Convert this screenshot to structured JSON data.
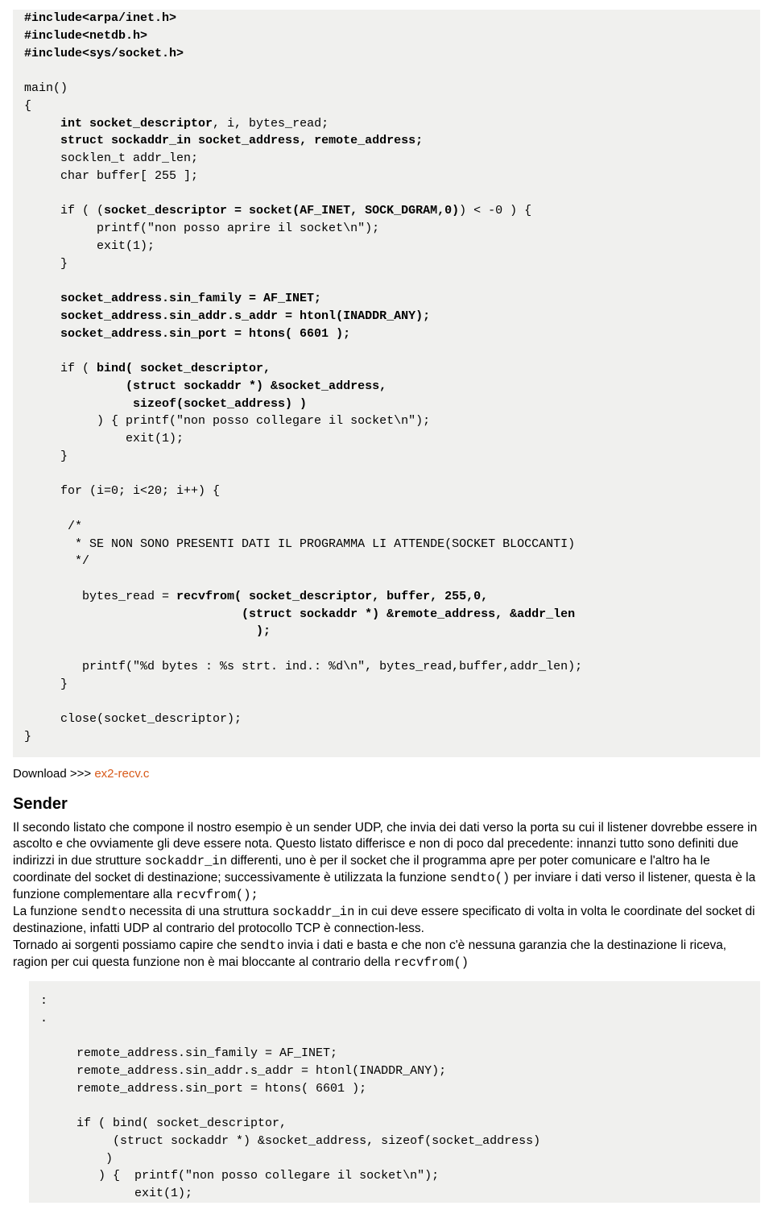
{
  "code1": {
    "l01": "#include<arpa/inet.h>",
    "l02": "#include<netdb.h>",
    "l03": "#include<sys/socket.h>",
    "l04": "",
    "l05": "main()",
    "l06": "{",
    "l07a": "     ",
    "l07b": "int socket_descriptor",
    "l07c": ", i, bytes_read;",
    "l08a": "     ",
    "l08b": "struct sockaddr_in socket_address, remote_address;",
    "l09": "     socklen_t addr_len;",
    "l10": "     char buffer[ 255 ];",
    "l11": "",
    "l12a": "     if ( (",
    "l12b": "socket_descriptor = socket(AF_INET, SOCK_DGRAM,0)",
    "l12c": ") < -0 ) {",
    "l13": "          printf(\"non posso aprire il socket\\n\");",
    "l14": "          exit(1);",
    "l15": "     }",
    "l16": "",
    "l17": "     socket_address.sin_family = AF_INET;",
    "l18": "     socket_address.sin_addr.s_addr = htonl(INADDR_ANY);",
    "l19": "     socket_address.sin_port = htons( 6601 );",
    "l20": "",
    "l21a": "     if ( ",
    "l21b": "bind( socket_descriptor,",
    "l22": "              (struct sockaddr *) &socket_address,",
    "l23": "               sizeof(socket_address) )",
    "l24": "          ) { printf(\"non posso collegare il socket\\n\");",
    "l25": "              exit(1);",
    "l26": "     }",
    "l27": "",
    "l28": "     for (i=0; i<20; i++) {",
    "l29": "",
    "l30": "      /*",
    "l31": "       * SE NON SONO PRESENTI DATI IL PROGRAMMA LI ATTENDE(SOCKET BLOCCANTI)",
    "l32": "       */",
    "l33": "",
    "l34a": "        bytes_read = ",
    "l34b": "recvfrom( socket_descriptor, buffer, 255,0,",
    "l35": "                              (struct sockaddr *) &remote_address, &addr_len",
    "l36": "                                );",
    "l37": "",
    "l38": "        printf(\"%d bytes : %s strt. ind.: %d\\n\", bytes_read,buffer,addr_len);",
    "l39": "     }",
    "l40": "",
    "l41": "     close(socket_descriptor);",
    "l42": "}"
  },
  "download": {
    "label": "Download >>> ",
    "link": "ex2-recv.c"
  },
  "heading": "Sender",
  "prose": {
    "p1a": "Il secondo listato che compone il nostro esempio è un sender UDP, che invia dei dati verso la porta su cui il listener dovrebbe essere in ascolto e che ovviamente gli deve essere nota. Questo listato differisce e non di poco dal precedente: innanzi tutto sono definiti due indirizzi in due strutture ",
    "p1b": "sockaddr_in",
    "p1c": "  differenti, uno è per il socket che il programma apre per poter comunicare e l'altro ha le coordinate del socket di destinazione; successivamente è utilizzata la funzione ",
    "p1d": "sendto()",
    "p1e": " per inviare i dati verso il listener, questa è la funzione complementare alla ",
    "p1f": "recvfrom();",
    "p2a": "La funzione ",
    "p2b": "sendto",
    "p2c": " necessita di una struttura ",
    "p2d": "sockaddr_in",
    "p2e": " in cui deve essere specificato di volta in volta le coordinate del socket di destinazione, infatti UDP al contrario del protocollo TCP è connection-less.",
    "p3a": "Tornado ai sorgenti possiamo capire che s",
    "p3b": "endto",
    "p3c": " invia i dati e basta e che non c'è nessuna garanzia che la destinazione li riceva, ragion per cui questa funzione non è mai bloccante al contrario della  ",
    "p3d": "recvfrom()"
  },
  "code2": {
    "l00": ":",
    "l01": ".",
    "l02": "",
    "l03": "     remote_address.sin_family = AF_INET;",
    "l04": "     remote_address.sin_addr.s_addr = htonl(INADDR_ANY);",
    "l05": "     remote_address.sin_port = htons( 6601 );",
    "l06": "",
    "l07": "     if ( bind( socket_descriptor,",
    "l08": "          (struct sockaddr *) &socket_address, sizeof(socket_address)",
    "l09": "         )",
    "l10": "        ) {  printf(\"non posso collegare il socket\\n\");",
    "l11": "             exit(1);"
  }
}
